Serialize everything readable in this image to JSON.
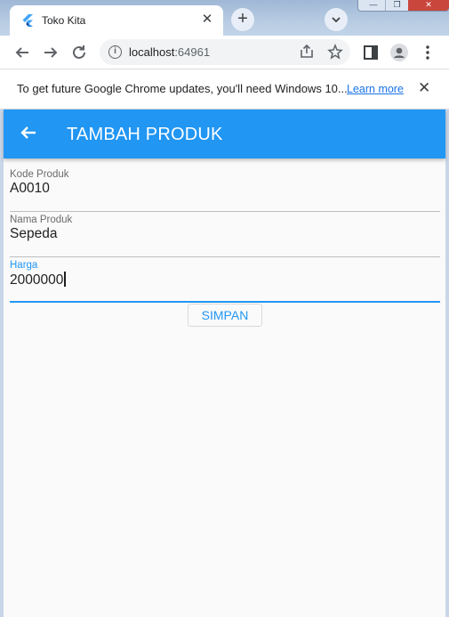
{
  "browser": {
    "tab_title": "Toko Kita",
    "tab_close_icon": "close-icon",
    "new_tab_label": "+",
    "tab_search_label": "⌄",
    "url_host": "localhost",
    "url_port": ":64961",
    "window_controls": {
      "minimize": "—",
      "maximize": "❐",
      "close": "✕"
    }
  },
  "infobar": {
    "message": "To get future Google Chrome updates, you'll need Windows 10...",
    "link": "Learn more"
  },
  "appbar": {
    "title": "TAMBAH PRODUK",
    "back_icon": "arrow-back-icon"
  },
  "form": {
    "fields": [
      {
        "label": "Kode Produk",
        "value": "A0010"
      },
      {
        "label": "Nama Produk",
        "value": "Sepeda"
      },
      {
        "label": "Harga",
        "value": "2000000"
      }
    ],
    "submit_label": "SIMPAN"
  },
  "colors": {
    "primary": "#2196f3",
    "background": "#fafafa"
  }
}
